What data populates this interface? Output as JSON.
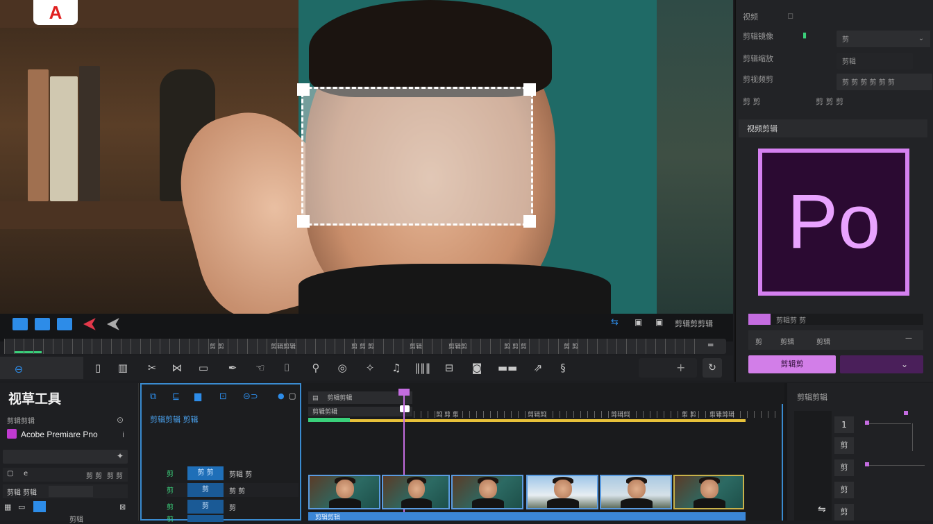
{
  "viewer": {
    "logo_text": "A"
  },
  "right_panel": {
    "rows": [
      {
        "label": "视频",
        "value": ""
      },
      {
        "label": "剪辑镜像",
        "value": "剪"
      },
      {
        "label": "剪辑缩放",
        "value": "剪辑"
      },
      {
        "label": "剪视频剪",
        "value": "剪 剪 剪 剪 剪 剪"
      },
      {
        "label": "剪 剪",
        "value": "剪 剪 剪"
      }
    ],
    "section_header": "视频剪辑",
    "app_logo_text": "Po",
    "slider_label": "剪辑剪 剪",
    "tab_a": "剪",
    "tab_b": "剪辑",
    "tab_c": "剪辑",
    "button_label": "剪辑剪",
    "dropdown_icon": "⌄"
  },
  "transport": {
    "labels": [
      "剪辑剪剪辑"
    ]
  },
  "timeline": {
    "ticks": [
      "剪 剪",
      "剪辑剪辑",
      "剪 剪 剪",
      "剪辑",
      "剪辑剪",
      "剪 剪 剪",
      "剪 剪",
      "剪 剪"
    ]
  },
  "left_panel": {
    "title": "视草工具",
    "subtitle": "剪辑剪辑",
    "app_name": "Acobe Premiare Pno",
    "input_text": "e",
    "items": [
      "剪 剪",
      "剪 剪",
      "剪辑 剪辑",
      "剪辑"
    ]
  },
  "mid_panel": {
    "title": "剪辑剪辑 剪辑",
    "rows": [
      {
        "a": "剪",
        "b": "剪 剪",
        "c": "剪辑 剪"
      },
      {
        "a": "剪",
        "b": "剪",
        "c": "剪 剪"
      },
      {
        "a": "剪",
        "b": "剪",
        "c": "剪"
      },
      {
        "a": "剪",
        "b": "剪",
        "c": "剪辑"
      }
    ]
  },
  "tl_panel": {
    "track_label": "剪辑剪辑",
    "track_sub": "剪辑剪辑",
    "ruler": [
      "剪 剪 剪",
      "剪辑剪",
      "剪辑剪",
      "剪 剪",
      "剪辑剪辑"
    ],
    "clip_caption": "剪辑剪辑"
  },
  "far_right": {
    "title": "剪辑剪辑",
    "button_1": "1",
    "items": [
      "剪",
      "剪",
      "剪",
      "剪"
    ]
  },
  "colors": {
    "accent_blue": "#2d8ce8",
    "accent_pink": "#d27ee8",
    "accent_purple": "#4a1f5a",
    "playhead": "#c46ce0",
    "timeline_yellow": "#e8c23a"
  }
}
